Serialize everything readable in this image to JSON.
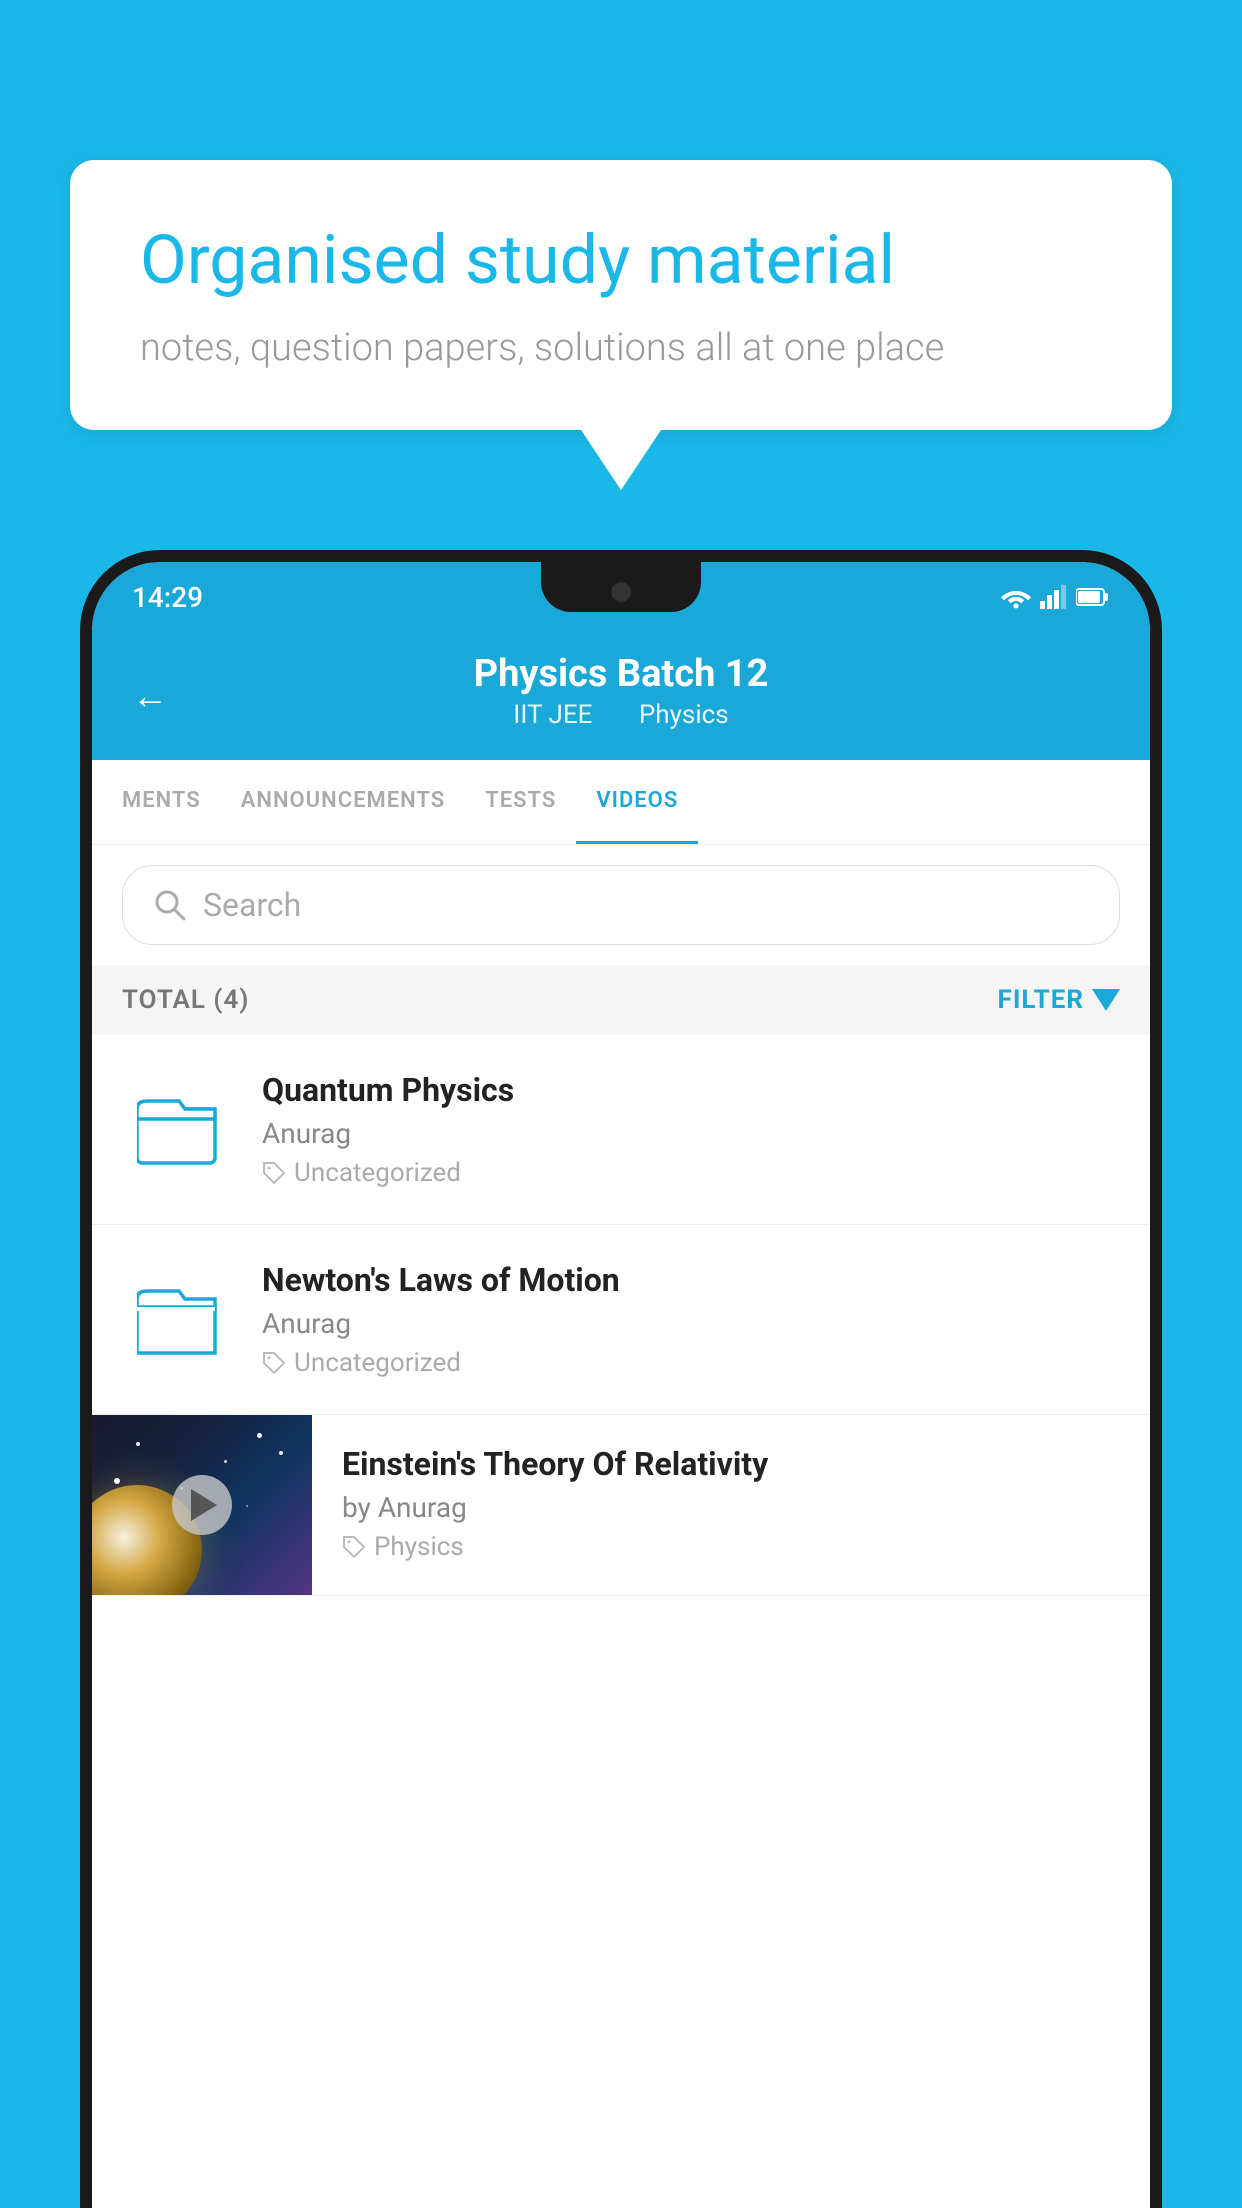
{
  "background": {
    "color": "#1ab8e8"
  },
  "speech_bubble": {
    "heading": "Organised study material",
    "subtext": "notes, question papers, solutions all at one place"
  },
  "phone": {
    "status_bar": {
      "time": "14:29",
      "icons": [
        "wifi",
        "signal",
        "battery"
      ]
    },
    "header": {
      "back_label": "←",
      "title": "Physics Batch 12",
      "subtitle_1": "IIT JEE",
      "subtitle_2": "Physics"
    },
    "tabs": [
      {
        "label": "MENTS",
        "active": false
      },
      {
        "label": "ANNOUNCEMENTS",
        "active": false
      },
      {
        "label": "TESTS",
        "active": false
      },
      {
        "label": "VIDEOS",
        "active": true
      }
    ],
    "search": {
      "placeholder": "Search"
    },
    "filter_bar": {
      "total_label": "TOTAL (4)",
      "filter_label": "FILTER"
    },
    "videos": [
      {
        "id": 1,
        "title": "Quantum Physics",
        "author": "Anurag",
        "tag": "Uncategorized",
        "type": "folder"
      },
      {
        "id": 2,
        "title": "Newton's Laws of Motion",
        "author": "Anurag",
        "tag": "Uncategorized",
        "type": "folder"
      },
      {
        "id": 3,
        "title": "Einstein's Theory Of Relativity",
        "author": "by Anurag",
        "tag": "Physics",
        "type": "video"
      }
    ]
  }
}
